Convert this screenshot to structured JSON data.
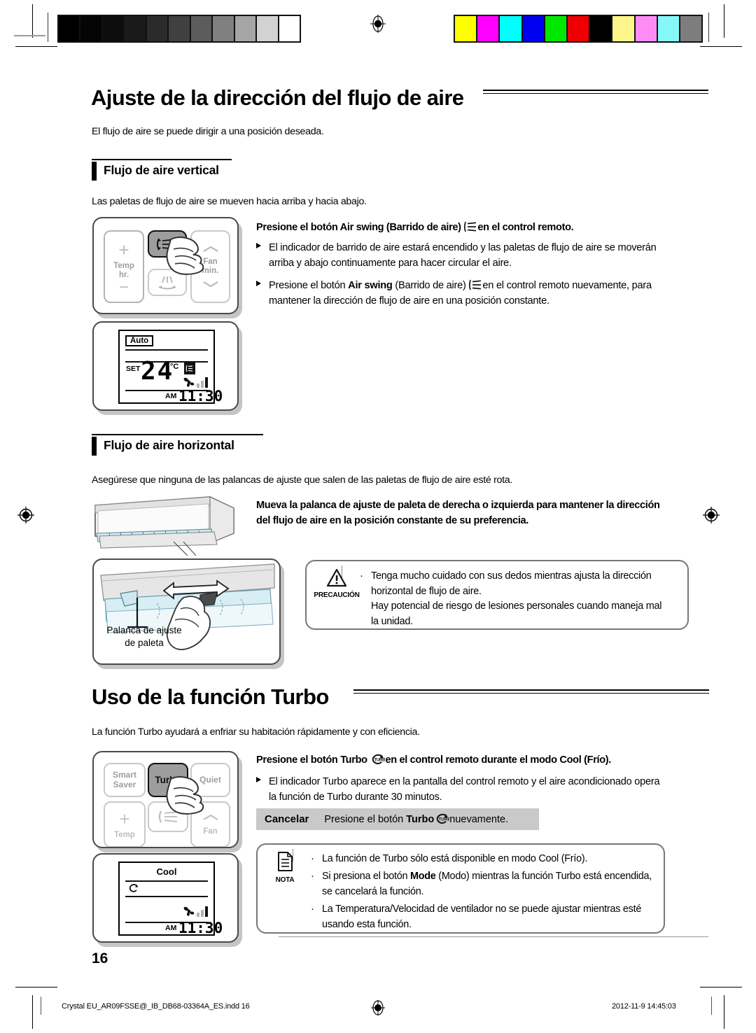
{
  "page": {
    "number": "16",
    "footer_left": "Crystal EU_AR09FSSE@_IB_DB68-03364A_ES.indd   16",
    "footer_right": "2012-11-9   14:45:03"
  },
  "colors": {
    "grayscale_bar": [
      "#000000",
      "#050505",
      "#0d0d0d",
      "#1a1a1a",
      "#2b2b2b",
      "#404040",
      "#5c5c5c",
      "#808080",
      "#a6a6a6",
      "#d2d2d2",
      "#ffffff"
    ],
    "color_bar": [
      "#ffff00",
      "#ff00ff",
      "#00ffff",
      "#0000f0",
      "#00e800",
      "#ee0000",
      "#000000",
      "#fdf68a",
      "#ff8cf5",
      "#86f7f7",
      "#7d7d7d"
    ],
    "accent_rule": "#000000",
    "callout_border": "#777777",
    "cancel_bar_bg": "#c9c9c9",
    "button_face": "#9d9d9d"
  },
  "section1": {
    "title": "Ajuste de la dirección del flujo de aire",
    "intro": "El flujo de aire se puede dirigir a una posición deseada.",
    "sub1": {
      "heading": "Flujo de aire vertical",
      "lead": "Las paletas de flujo de aire se mueven hacia arriba y hacia abajo.",
      "instruction_prefix": "Presione el botón ",
      "instruction_bold": "Air swing",
      "instruction_mid": " (Barrido de aire) ",
      "instruction_icon": "air-swing-icon",
      "instruction_suffix": "en el control remoto.",
      "bullets": [
        {
          "marker": "triangle-bullet",
          "text": "El indicador de barrido de aire estará encendido y las paletas de flujo de aire se moverán arriba y abajo continuamente para hacer circular el aire."
        },
        {
          "marker": "triangle-bullet",
          "pre": "Presione el botón ",
          "bold": "Air swing",
          "mid": " (Barrido de aire) ",
          "icon": "air-swing-icon",
          "post": "en el control remoto nuevamente, para mantener la dirección de flujo de aire en una posición constante."
        }
      ],
      "remote": {
        "buttons": [
          {
            "name": "temp-up-button",
            "label": "+"
          },
          {
            "name": "temp-label",
            "label": "Temp\nhr."
          },
          {
            "name": "temp-down-button",
            "label": "−"
          },
          {
            "name": "air-swing-vertical-button",
            "label": "air-swing-vertical-icon",
            "state": "pressed"
          },
          {
            "name": "air-swing-horizontal-button",
            "label": "air-swing-horizontal-icon"
          },
          {
            "name": "fan-up-button",
            "label": "chevron-up-icon"
          },
          {
            "name": "fan-label",
            "label": "Fan\nmin."
          },
          {
            "name": "fan-down-button",
            "label": "chevron-down-icon"
          }
        ],
        "hand_cursor": "pointing-hand-icon"
      },
      "display": {
        "mode": "Auto",
        "set_label": "SET",
        "temperature": "24",
        "unit": "°C",
        "swing_icon": "swing-indicator-icon",
        "fan_icon": "fan-icon",
        "fan_bars": "fan-speed-bars-icon",
        "meridiem": "AM",
        "time": "11:30"
      }
    },
    "sub2": {
      "heading": "Flujo de aire horizontal",
      "lead": "Asegúrese que ninguna de las palancas de ajuste que salen de las paletas de flujo de aire esté rota.",
      "instruction": "Mueva la palanca de ajuste de paleta de derecha o izquierda para mantener la dirección del flujo de aire en la posición constante de su preferencia.",
      "lever_caption": "Palanca de ajuste\nde paleta",
      "unit_illustration": "indoor-air-conditioner-unit",
      "detail_illustration": "blade-adjustment-lever-detail",
      "caution": {
        "icon": "warning-triangle-icon",
        "label": "PRECAUCIÓN",
        "items": [
          "Tenga mucho cuidado con sus dedos mientras ajusta la dirección horizontal de flujo de aire.\nHay potencial de riesgo de lesiones personales cuando maneja mal la unidad."
        ]
      }
    }
  },
  "section2": {
    "title": "Uso de la función Turbo",
    "intro": "La función Turbo ayudará a enfriar su habitación rápidamente y con eficiencia.",
    "instruction_prefix": "Presione el botón ",
    "instruction_bold": "Turbo",
    "instruction_icon": "turbo-icon",
    "instruction_suffix": "en el control remoto durante el modo Cool (Frío).",
    "bullets": [
      {
        "marker": "triangle-bullet",
        "text": "El indicador Turbo aparece en la pantalla del control remoto y el aire acondicionado opera la función de Turbo durante 30 minutos."
      }
    ],
    "cancel": {
      "label": "Cancelar",
      "pre": "Presione el botón ",
      "bold": "Turbo",
      "icon": "turbo-icon",
      "post": "nuevamente."
    },
    "remote": {
      "buttons": [
        {
          "name": "smart-saver-button",
          "label": "Smart\nSaver"
        },
        {
          "name": "turbo-button",
          "label": "Turbo",
          "state": "pressed"
        },
        {
          "name": "quiet-button",
          "label": "Quiet"
        },
        {
          "name": "temp-up-button",
          "label": "+"
        },
        {
          "name": "temp-label",
          "label": "Temp"
        },
        {
          "name": "air-swing-button",
          "label": "air-swing-vertical-icon"
        },
        {
          "name": "fan-up-button",
          "label": "chevron-up-icon"
        },
        {
          "name": "fan-label",
          "label": "Fan"
        }
      ],
      "hand_cursor": "pointing-hand-icon"
    },
    "display": {
      "mode": "Cool",
      "turbo_icon": "turbo-indicator-icon",
      "fan_icon": "fan-icon",
      "fan_bars": "fan-speed-bars-icon",
      "meridiem": "AM",
      "time": "11:30"
    },
    "note": {
      "icon": "note-document-icon",
      "label": "NOTA",
      "items": [
        {
          "text": "La función de Turbo sólo está disponible en modo Cool (Frío)."
        },
        {
          "pre": "Si presiona el botón  ",
          "bold": "Mode",
          "post": " (Modo) mientras la función Turbo está encendida, se cancelará la función."
        },
        {
          "text": "La Temperatura/Velocidad de ventilador no se puede ajustar mientras esté usando esta función."
        }
      ]
    }
  }
}
